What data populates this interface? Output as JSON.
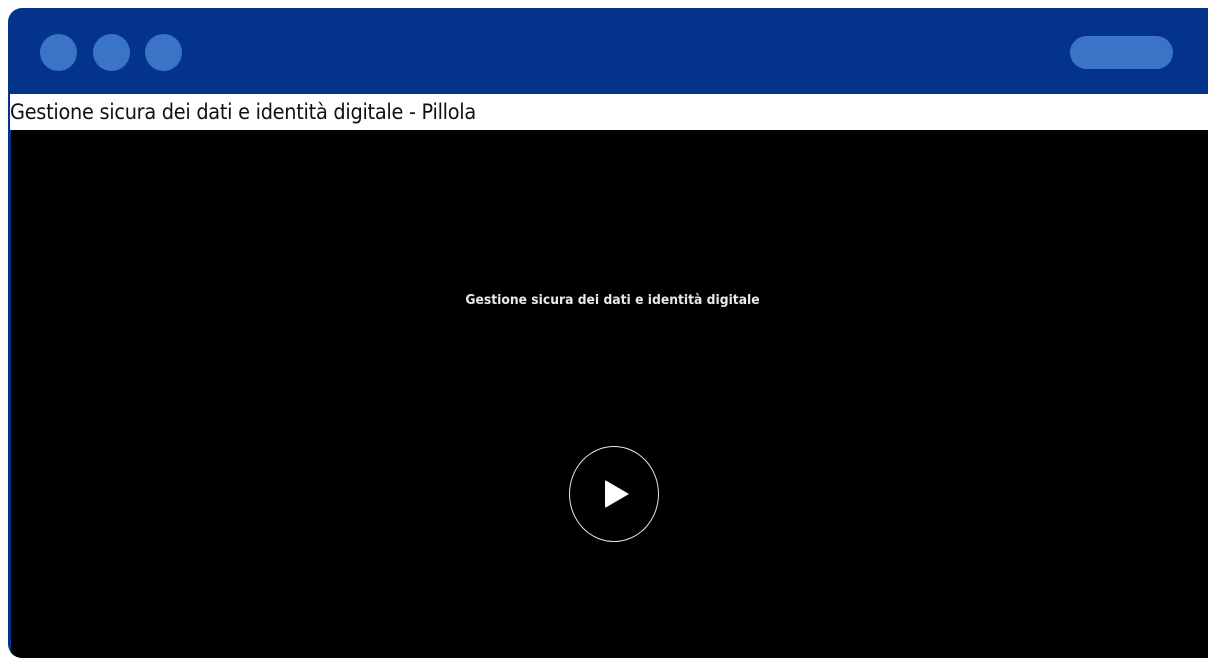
{
  "window": {
    "controls": [
      "window-dot",
      "window-dot",
      "window-dot"
    ]
  },
  "header": {
    "title": "Gestione sicura dei dati e identità digitale - Pillola"
  },
  "video": {
    "caption": "Gestione sicura dei dati e identità digitale",
    "play_icon": "play-icon"
  },
  "colors": {
    "frame": "#03338a",
    "accent": "#3b74c7",
    "video_bg": "#000000"
  }
}
